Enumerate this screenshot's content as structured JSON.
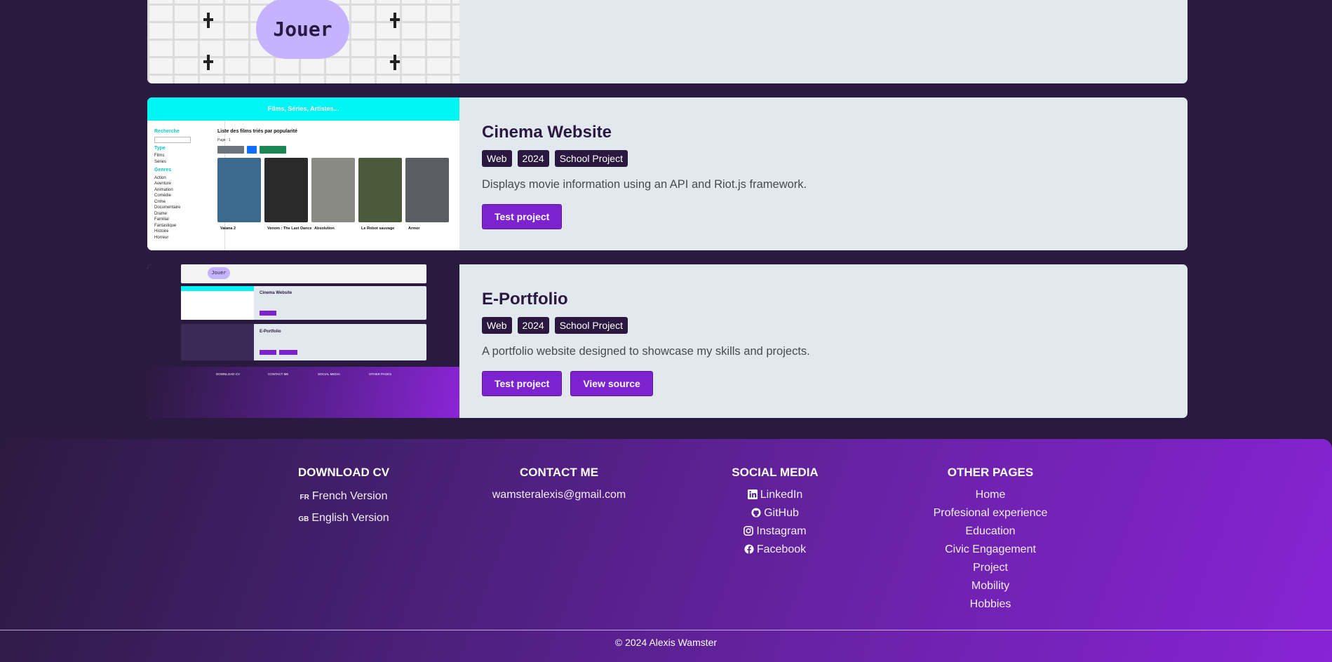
{
  "projects": [
    {
      "thumb_play_label": "Jouer"
    },
    {
      "title": "Cinema Website",
      "tags": [
        "Web",
        "2024",
        "School Project"
      ],
      "description": "Displays movie information using an API and Riot.js framework.",
      "buttons": [
        "Test project"
      ],
      "thumb": {
        "header": "Films, Séries, Artistes...",
        "sidebar_search": "Recherche",
        "sidebar_type": "Type",
        "type_items": [
          "Films",
          "Séries"
        ],
        "sidebar_genres": "Genres",
        "genre_items": [
          "Action",
          "Aventure",
          "Animation",
          "Comédie",
          "Crime",
          "Documentaire",
          "Drame",
          "Familial",
          "Fantastique",
          "Histoire",
          "Horreur"
        ],
        "list_title": "Liste des films triés par popularité",
        "page": "Page : 1",
        "posters": [
          {
            "title": "Vaiana 2",
            "color": "#3c6a8f"
          },
          {
            "title": "Venom : The Last Dance",
            "color": "#2a2a2a"
          },
          {
            "title": "Absolution",
            "color": "#8a8a84"
          },
          {
            "title": "Le Robot sauvage",
            "color": "#4a5a3a"
          },
          {
            "title": "Armor",
            "color": "#5a5e62"
          }
        ]
      }
    },
    {
      "title": "E-Portfolio",
      "tags": [
        "Web",
        "2024",
        "School Project"
      ],
      "description": "A portfolio website designed to showcase my skills and projects.",
      "buttons": [
        "Test project",
        "View source"
      ],
      "thumb": {
        "play_label": "Jouer",
        "mini_cards": [
          "Cinema Website",
          "E-Portfolio"
        ],
        "footer_cols": [
          "DOWNLOAD CV",
          "CONTACT ME",
          "SOCIAL MEDIA",
          "OTHER PAGES"
        ]
      }
    }
  ],
  "footer": {
    "download_cv": {
      "heading": "DOWNLOAD CV",
      "items": [
        {
          "flag": "FR",
          "label": "French Version"
        },
        {
          "flag": "GB",
          "label": "English Version"
        }
      ]
    },
    "contact": {
      "heading": "CONTACT ME",
      "email": "wamsteralexis@gmail.com"
    },
    "social": {
      "heading": "SOCIAL MEDIA",
      "items": [
        {
          "icon": "linkedin-icon",
          "label": "LinkedIn"
        },
        {
          "icon": "github-icon",
          "label": "GitHub"
        },
        {
          "icon": "instagram-icon",
          "label": "Instagram"
        },
        {
          "icon": "facebook-icon",
          "label": "Facebook"
        }
      ]
    },
    "other_pages": {
      "heading": "OTHER PAGES",
      "items": [
        "Home",
        "Profesional experience",
        "Education",
        "Civic Engagement",
        "Project",
        "Mobility",
        "Hobbies"
      ]
    },
    "copyright": "© 2024 Alexis Wamster"
  },
  "colors": {
    "page_bg": "#2b1a40",
    "card_bg": "#e1e9ee",
    "accent": "#7d22cf",
    "tag_bg": "#2a1840"
  }
}
